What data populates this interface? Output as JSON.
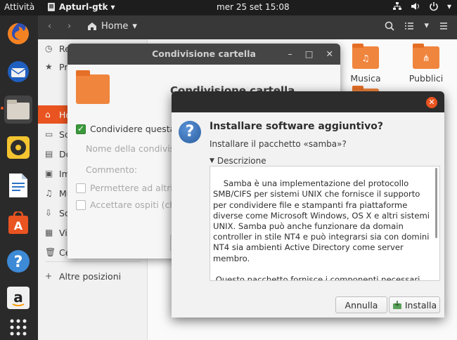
{
  "topbar": {
    "activities": "Attività",
    "app_name": "Apturl-gtk",
    "clock": "mer 25 set  15:08",
    "icons": [
      "network-icon",
      "volume-icon",
      "power-icon",
      "chevron-down-icon"
    ]
  },
  "dock": {
    "items": [
      "firefox-icon",
      "thunderbird-icon",
      "files-icon",
      "rhythmbox-icon",
      "writer-icon",
      "software-icon",
      "help-icon",
      "amazon-icon",
      "apps-grid-icon"
    ]
  },
  "files": {
    "location": "Home",
    "sidebar": [
      {
        "label": "Recenti",
        "icon": "clock-icon"
      },
      {
        "label": "Preferiti",
        "icon": "star-icon"
      },
      {
        "label": "Home",
        "icon": "home-icon"
      },
      {
        "label": "Scrivania",
        "icon": "desktop-icon"
      },
      {
        "label": "Documenti",
        "icon": "document-icon"
      },
      {
        "label": "Immagini",
        "icon": "image-icon"
      },
      {
        "label": "Musica",
        "icon": "music-icon"
      },
      {
        "label": "Scaricati",
        "icon": "download-icon"
      },
      {
        "label": "Video",
        "icon": "video-icon"
      },
      {
        "label": "Cestino",
        "icon": "trash-icon"
      }
    ],
    "other_places": "Altre posizioni",
    "folders": [
      {
        "label": "Musica",
        "icon": "music-icon"
      },
      {
        "label": "Pubblici",
        "icon": "share-icon"
      }
    ]
  },
  "share_dialog": {
    "window_title": "Condivisione cartella",
    "heading": "Condivisione cartella",
    "share_checkbox": "Condividere questa cartella",
    "name_label": "Nome della condivisione",
    "comment_label": "Commento:",
    "allow_others": "Permettere ad altri di creare ed eliminare file",
    "guest_access": "Accettare ospiti (chi non ha un account utente)"
  },
  "install_dialog": {
    "title": "Installare software aggiuntivo?",
    "subtitle": "Installare il pacchetto «samba»?",
    "expander": "Descrizione",
    "description": "Samba è una implementazione del protocollo SMB/CIFS per sistemi UNIX che fornisce il supporto per condividere file e stampanti fra piattaforme diverse come Microsoft Windows, OS X e altri sistemi UNIX. Samba può anche funzionare da domain controller in stile NT4 e può integrarsi sia con domini NT4 sia ambienti Active Directory come server membro.\n\n Questo pacchetto fornisce i componenti necessari per usare Samba come server di file e stampanti autonomo o come controllore di dominio NT4 o Active Directory. Per usarlo in un dominio NT4 o in un ambiente Active Directory è necessario anche il pacchetto winbind.",
    "cancel_label": "Annulla",
    "install_label": "Installa",
    "accent": "#e95420"
  }
}
